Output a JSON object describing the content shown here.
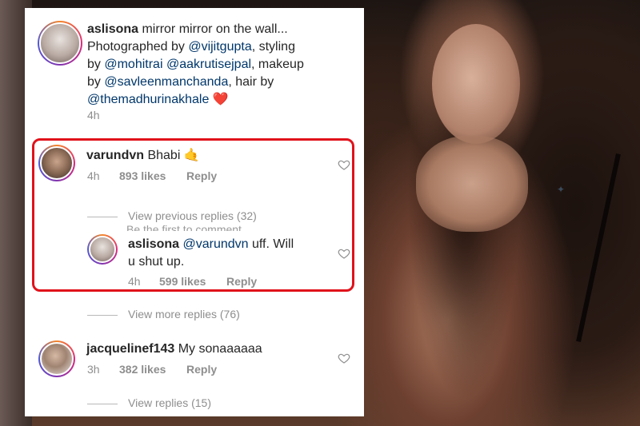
{
  "caption": {
    "username": "aslisona",
    "line1_text": " mirror mirror on the wall...",
    "line2_text": "Photographed by ",
    "line2_mention": "@vijitgupta",
    "line2_tail": ", styling",
    "line3_prefix": "by ",
    "line3_mention1": "@mohitrai",
    "line3_mention2": "@aakrutisejpal",
    "line3_tail": ", makeup",
    "line4_prefix": "by ",
    "line4_mention": "@savleenmanchanda",
    "line4_tail": ", hair by",
    "line5_mention": "@themadhurinakhale",
    "line5_emoji": "❤️",
    "time": "4h"
  },
  "comments": [
    {
      "username": "varundvn",
      "text": " Bhabi ",
      "emoji": "🤙",
      "time": "4h",
      "likes": "893 likes",
      "reply": "Reply",
      "view_previous": "View previous replies (32)",
      "overlap_text": "Be the first to comment"
    },
    {
      "username": "aslisona",
      "mention": "@varundvn",
      "text_line1_tail": " uff. Will",
      "text_line2": "u shut up.",
      "time": "4h",
      "likes": "599 likes",
      "reply": "Reply"
    },
    {
      "view_more": "View more replies (76)"
    },
    {
      "username": "jacquelinef143",
      "text": " My sonaaaaaa",
      "time": "3h",
      "likes": "382 likes",
      "reply": "Reply",
      "view_replies": "View replies (15)"
    }
  ],
  "colors": {
    "highlight_border": "#e0121b",
    "mention": "#00376b",
    "meta": "#8e8e8e",
    "heart": "#e0121b"
  },
  "icons": [
    "heart-icon",
    "like-heart-icon"
  ]
}
